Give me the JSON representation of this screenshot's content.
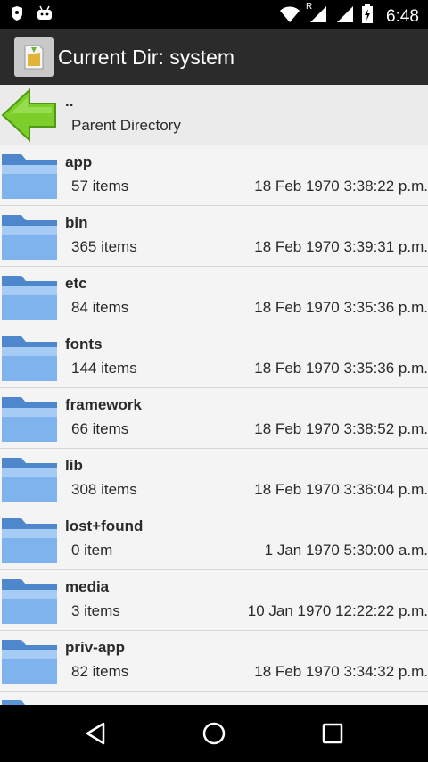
{
  "status_bar": {
    "time": "6:48",
    "signal_indicator": "R",
    "icons": [
      "shield-icon",
      "android-icon",
      "wifi-icon",
      "signal-icon",
      "signal-icon",
      "battery-charging-icon"
    ]
  },
  "app_bar": {
    "title": "Current Dir: system"
  },
  "parent_row": {
    "name": "..",
    "label": "Parent Directory"
  },
  "entries": [
    {
      "name": "app",
      "count": "57 items",
      "date": "18 Feb 1970 3:38:22 p.m."
    },
    {
      "name": "bin",
      "count": "365 items",
      "date": "18 Feb 1970 3:39:31 p.m."
    },
    {
      "name": "etc",
      "count": "84 items",
      "date": "18 Feb 1970 3:35:36 p.m."
    },
    {
      "name": "fonts",
      "count": "144 items",
      "date": "18 Feb 1970 3:35:36 p.m."
    },
    {
      "name": "framework",
      "count": "66 items",
      "date": "18 Feb 1970 3:38:52 p.m."
    },
    {
      "name": "lib",
      "count": "308 items",
      "date": "18 Feb 1970 3:36:04 p.m."
    },
    {
      "name": "lost+found",
      "count": "0 item",
      "date": "1 Jan 1970 5:30:00 a.m."
    },
    {
      "name": "media",
      "count": "3 items",
      "date": "10 Jan 1970 12:22:22 p.m."
    },
    {
      "name": "priv-app",
      "count": "82 items",
      "date": "18 Feb 1970 3:34:32 p.m."
    }
  ],
  "nav_bar": {
    "buttons": [
      "back-icon",
      "home-icon",
      "recents-icon"
    ]
  },
  "colors": {
    "status_bar": "#000000",
    "app_bar": "#2b2b2b",
    "list_background": "#f4f4f4",
    "folder_blue": "#6fa8e8",
    "arrow_green": "#7ccf2a"
  }
}
